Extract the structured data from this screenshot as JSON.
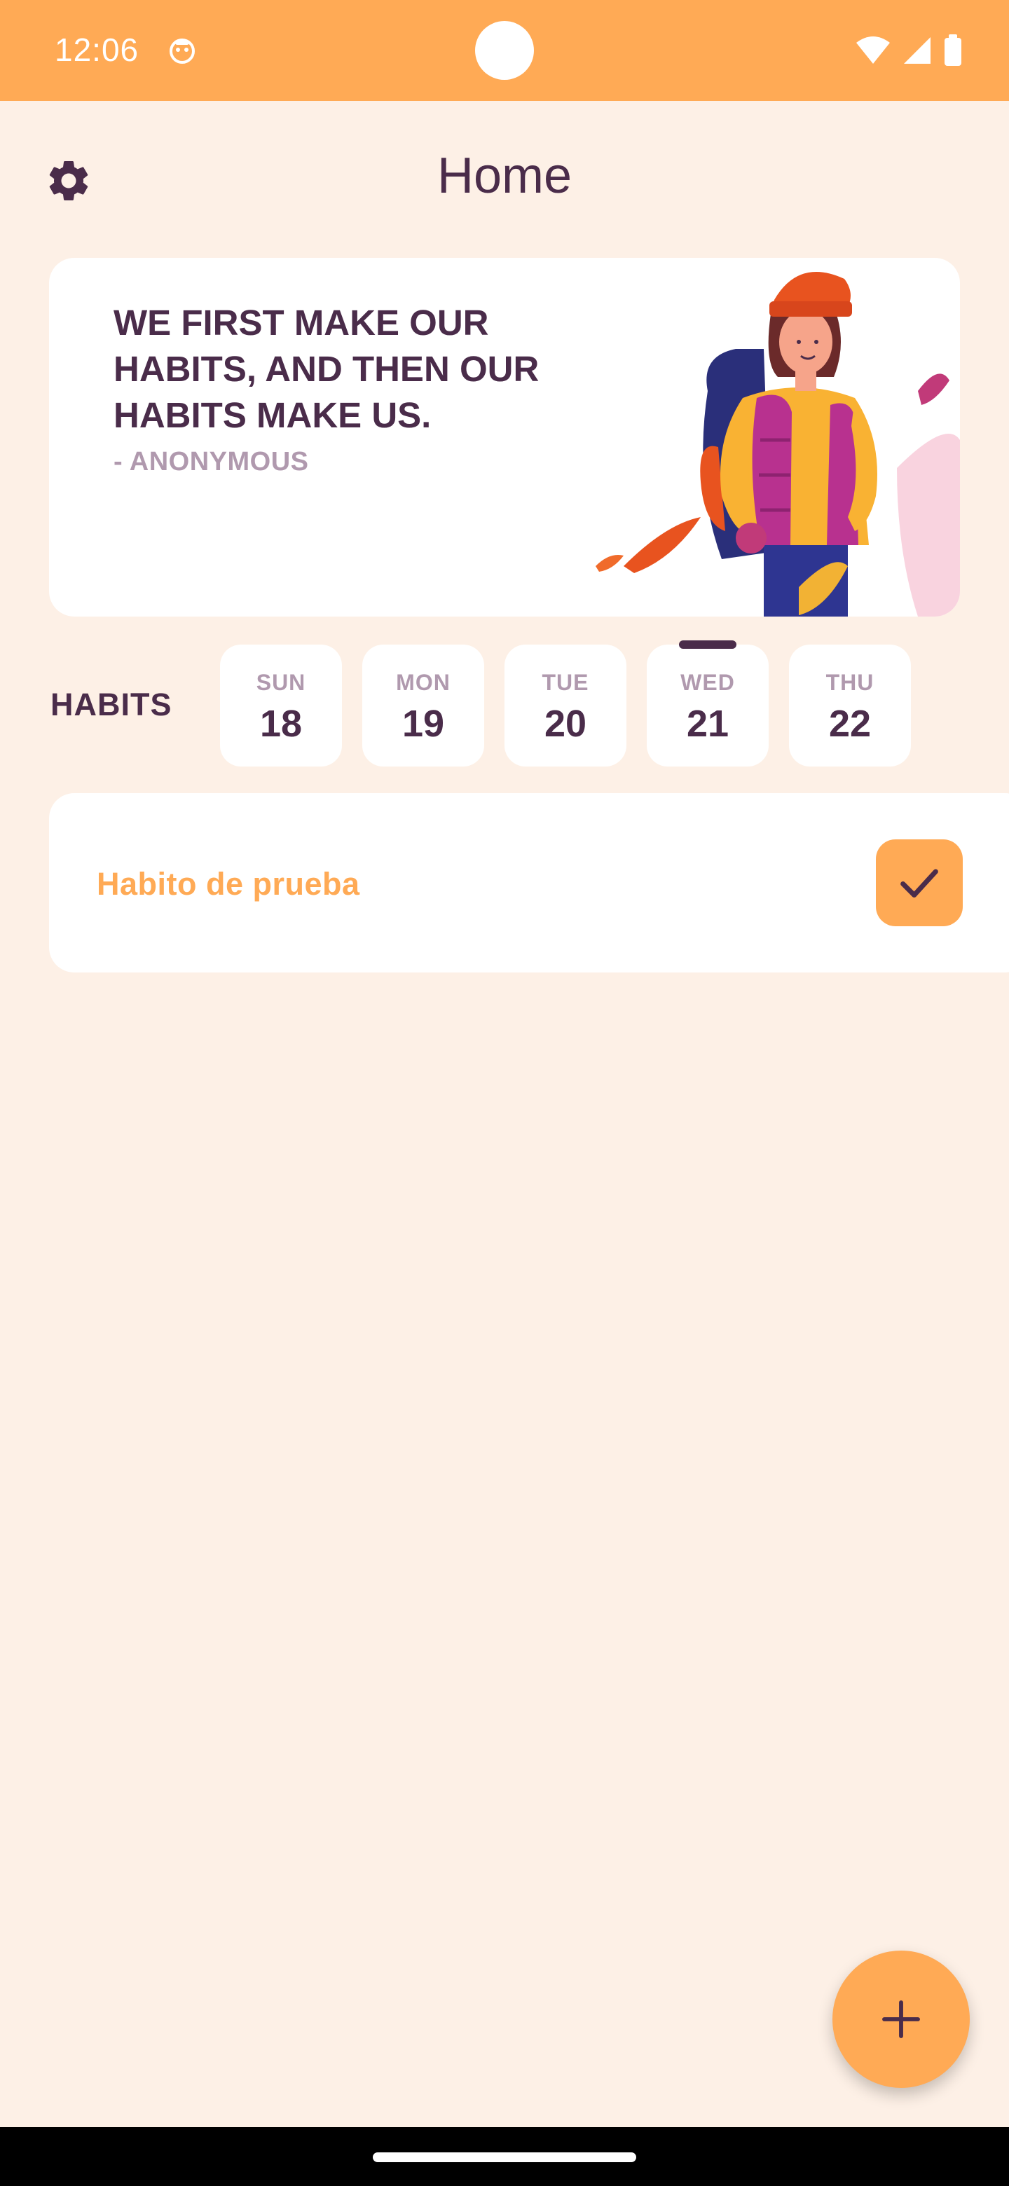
{
  "status_bar": {
    "time": "12:06",
    "background": "#FFAA55",
    "icons": [
      "app-notification-icon",
      "wifi-icon",
      "signal-icon",
      "battery-icon"
    ]
  },
  "header": {
    "title": "Home",
    "settings_icon": "gear-icon"
  },
  "quote": {
    "text": "WE FIRST MAKE OUR HABITS, AND THEN OUR HABITS MAKE US.",
    "author": "- ANONYMOUS"
  },
  "habits_section": {
    "label": "HABITS",
    "days": [
      {
        "name": "SUN",
        "number": "18",
        "selected": false
      },
      {
        "name": "MON",
        "number": "19",
        "selected": false
      },
      {
        "name": "TUE",
        "number": "20",
        "selected": false
      },
      {
        "name": "WED",
        "number": "21",
        "selected": true
      },
      {
        "name": "THU",
        "number": "22",
        "selected": false
      }
    ]
  },
  "habits": [
    {
      "name": "Habito de prueba",
      "completed": true
    }
  ],
  "fab": {
    "icon": "plus-icon"
  },
  "colors": {
    "accent": "#FFAA55",
    "background": "#FDF0E6",
    "text_dark": "#4A2C4A",
    "text_muted": "#B099AE",
    "card": "#FFFFFF"
  }
}
